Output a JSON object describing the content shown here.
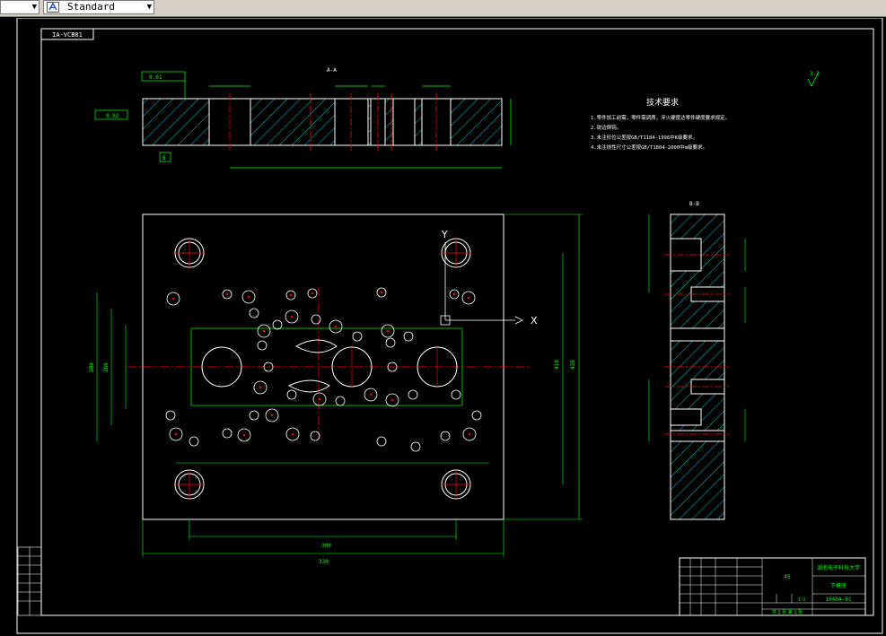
{
  "toolbar": {
    "left_combo_value": "",
    "style_combo_value": "Standard",
    "dropdown_arrow": "▼"
  },
  "drawing": {
    "frame_tag": "IA-VCB01",
    "section_label_aa": "A-A",
    "section_label_bb": "B-B",
    "roughness_right": "3.2",
    "tech_title": "技术要求",
    "tech_notes": [
      "1.零件加工前需，零件需调质，淬火硬度达零件硬度要求规定。",
      "2.锐边倒钝。",
      "3.未注形位公差按GB/T1184-1996中K级要求。",
      "4.未注线性尺寸公差按GB/T1804-2000中m级要求。"
    ],
    "axis_x": "X",
    "axis_y": "Y",
    "dims_bottom": [
      "300",
      "330"
    ],
    "dims_right": [
      "410",
      "430"
    ],
    "dims_left": [
      "300",
      "266"
    ],
    "tol_f": "0.01",
    "tol_b": "0.02",
    "datum": "B",
    "title_block": {
      "school": "湖南电子科技大学",
      "part_name": "下模座",
      "drawing_no": "1040A-01",
      "material": "45",
      "scale": "1:1",
      "sheet": "共 1 张  第 1 张"
    }
  },
  "colors": {
    "background": "#000000",
    "outline": "#ffffff",
    "dimension": "#00ff00",
    "centerline": "#ff0000",
    "hatch": "#00ffff"
  },
  "icons": [
    "text-style-icon",
    "dropdown-arrow-icon"
  ]
}
